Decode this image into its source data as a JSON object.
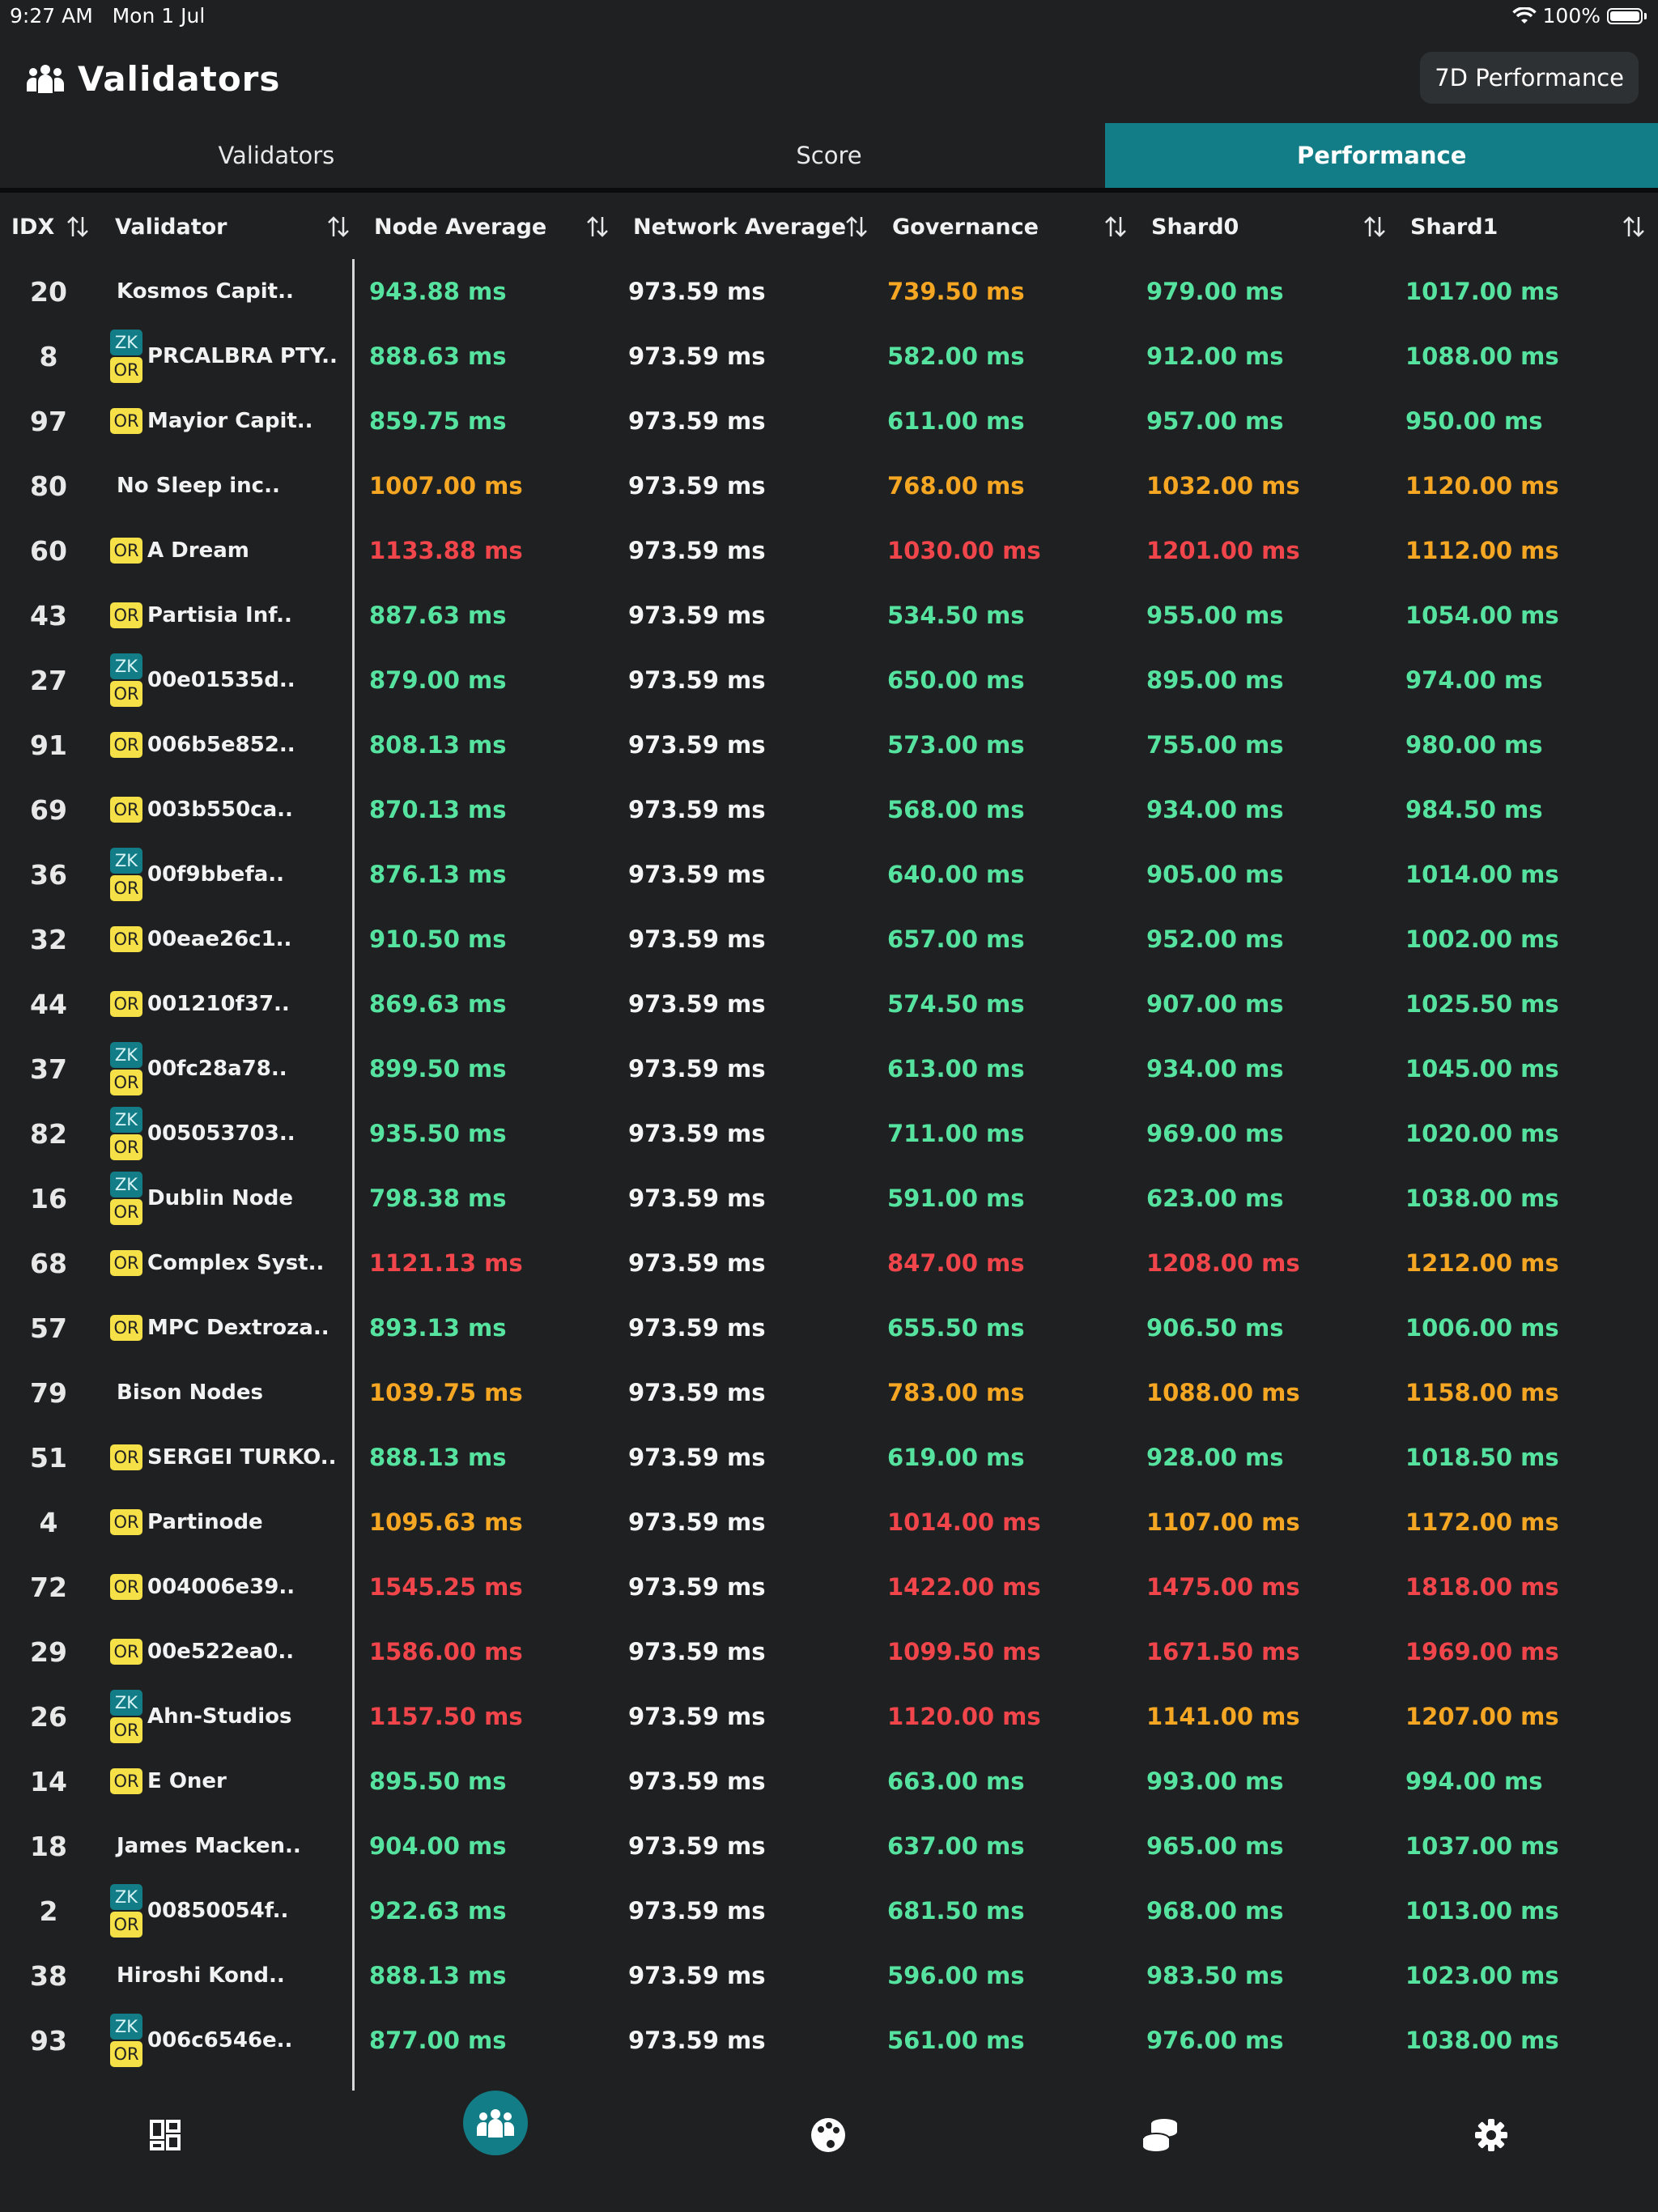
{
  "status": {
    "time": "9:27 AM",
    "date": "Mon 1 Jul",
    "battery": "100%"
  },
  "header": {
    "title": "Validators",
    "icon": "validators-group-icon",
    "perf_button": "7D Performance"
  },
  "tabs": [
    {
      "label": "Validators",
      "active": false
    },
    {
      "label": "Score",
      "active": false
    },
    {
      "label": "Performance",
      "active": true
    }
  ],
  "columns": [
    "IDX",
    "Validator",
    "Node Average",
    "Network Average",
    "Governance",
    "Shard0",
    "Shard1"
  ],
  "colors": {
    "good": "#56e3a0",
    "warn": "#f5a623",
    "bad": "#f0454a",
    "accent": "#127d86",
    "or_badge": "#f5e047"
  },
  "rows": [
    {
      "idx": "20",
      "name": "Kosmos Capit..",
      "zk": false,
      "or": false,
      "node": [
        "943.88 ms",
        "good"
      ],
      "net": "973.59 ms",
      "gov": [
        "739.50 ms",
        "warn"
      ],
      "s0": [
        "979.00 ms",
        "good"
      ],
      "s1": [
        "1017.00 ms",
        "good"
      ]
    },
    {
      "idx": "8",
      "name": "PRCALBRA PTY..",
      "zk": true,
      "or": true,
      "node": [
        "888.63 ms",
        "good"
      ],
      "net": "973.59 ms",
      "gov": [
        "582.00 ms",
        "good"
      ],
      "s0": [
        "912.00 ms",
        "good"
      ],
      "s1": [
        "1088.00 ms",
        "good"
      ]
    },
    {
      "idx": "97",
      "name": "Mayior Capit..",
      "zk": false,
      "or": true,
      "node": [
        "859.75 ms",
        "good"
      ],
      "net": "973.59 ms",
      "gov": [
        "611.00 ms",
        "good"
      ],
      "s0": [
        "957.00 ms",
        "good"
      ],
      "s1": [
        "950.00 ms",
        "good"
      ]
    },
    {
      "idx": "80",
      "name": "No Sleep inc..",
      "zk": false,
      "or": false,
      "node": [
        "1007.00 ms",
        "warn"
      ],
      "net": "973.59 ms",
      "gov": [
        "768.00 ms",
        "warn"
      ],
      "s0": [
        "1032.00 ms",
        "warn"
      ],
      "s1": [
        "1120.00 ms",
        "warn"
      ]
    },
    {
      "idx": "60",
      "name": "A Dream",
      "zk": false,
      "or": true,
      "node": [
        "1133.88 ms",
        "bad"
      ],
      "net": "973.59 ms",
      "gov": [
        "1030.00 ms",
        "bad"
      ],
      "s0": [
        "1201.00 ms",
        "bad"
      ],
      "s1": [
        "1112.00 ms",
        "warn"
      ]
    },
    {
      "idx": "43",
      "name": "Partisia Inf..",
      "zk": false,
      "or": true,
      "node": [
        "887.63 ms",
        "good"
      ],
      "net": "973.59 ms",
      "gov": [
        "534.50 ms",
        "good"
      ],
      "s0": [
        "955.00 ms",
        "good"
      ],
      "s1": [
        "1054.00 ms",
        "good"
      ]
    },
    {
      "idx": "27",
      "name": "00e01535d..",
      "zk": true,
      "or": true,
      "node": [
        "879.00 ms",
        "good"
      ],
      "net": "973.59 ms",
      "gov": [
        "650.00 ms",
        "good"
      ],
      "s0": [
        "895.00 ms",
        "good"
      ],
      "s1": [
        "974.00 ms",
        "good"
      ]
    },
    {
      "idx": "91",
      "name": "006b5e852..",
      "zk": false,
      "or": true,
      "node": [
        "808.13 ms",
        "good"
      ],
      "net": "973.59 ms",
      "gov": [
        "573.00 ms",
        "good"
      ],
      "s0": [
        "755.00 ms",
        "good"
      ],
      "s1": [
        "980.00 ms",
        "good"
      ]
    },
    {
      "idx": "69",
      "name": "003b550ca..",
      "zk": false,
      "or": true,
      "node": [
        "870.13 ms",
        "good"
      ],
      "net": "973.59 ms",
      "gov": [
        "568.00 ms",
        "good"
      ],
      "s0": [
        "934.00 ms",
        "good"
      ],
      "s1": [
        "984.50 ms",
        "good"
      ]
    },
    {
      "idx": "36",
      "name": "00f9bbefa..",
      "zk": true,
      "or": true,
      "node": [
        "876.13 ms",
        "good"
      ],
      "net": "973.59 ms",
      "gov": [
        "640.00 ms",
        "good"
      ],
      "s0": [
        "905.00 ms",
        "good"
      ],
      "s1": [
        "1014.00 ms",
        "good"
      ]
    },
    {
      "idx": "32",
      "name": "00eae26c1..",
      "zk": false,
      "or": true,
      "node": [
        "910.50 ms",
        "good"
      ],
      "net": "973.59 ms",
      "gov": [
        "657.00 ms",
        "good"
      ],
      "s0": [
        "952.00 ms",
        "good"
      ],
      "s1": [
        "1002.00 ms",
        "good"
      ]
    },
    {
      "idx": "44",
      "name": "001210f37..",
      "zk": false,
      "or": true,
      "node": [
        "869.63 ms",
        "good"
      ],
      "net": "973.59 ms",
      "gov": [
        "574.50 ms",
        "good"
      ],
      "s0": [
        "907.00 ms",
        "good"
      ],
      "s1": [
        "1025.50 ms",
        "good"
      ]
    },
    {
      "idx": "37",
      "name": "00fc28a78..",
      "zk": true,
      "or": true,
      "node": [
        "899.50 ms",
        "good"
      ],
      "net": "973.59 ms",
      "gov": [
        "613.00 ms",
        "good"
      ],
      "s0": [
        "934.00 ms",
        "good"
      ],
      "s1": [
        "1045.00 ms",
        "good"
      ]
    },
    {
      "idx": "82",
      "name": "005053703..",
      "zk": true,
      "or": true,
      "node": [
        "935.50 ms",
        "good"
      ],
      "net": "973.59 ms",
      "gov": [
        "711.00 ms",
        "good"
      ],
      "s0": [
        "969.00 ms",
        "good"
      ],
      "s1": [
        "1020.00 ms",
        "good"
      ]
    },
    {
      "idx": "16",
      "name": "Dublin Node",
      "zk": true,
      "or": true,
      "node": [
        "798.38 ms",
        "good"
      ],
      "net": "973.59 ms",
      "gov": [
        "591.00 ms",
        "good"
      ],
      "s0": [
        "623.00 ms",
        "good"
      ],
      "s1": [
        "1038.00 ms",
        "good"
      ]
    },
    {
      "idx": "68",
      "name": "Complex Syst..",
      "zk": false,
      "or": true,
      "node": [
        "1121.13 ms",
        "bad"
      ],
      "net": "973.59 ms",
      "gov": [
        "847.00 ms",
        "bad"
      ],
      "s0": [
        "1208.00 ms",
        "bad"
      ],
      "s1": [
        "1212.00 ms",
        "warn"
      ]
    },
    {
      "idx": "57",
      "name": "MPC Dextroza..",
      "zk": false,
      "or": true,
      "node": [
        "893.13 ms",
        "good"
      ],
      "net": "973.59 ms",
      "gov": [
        "655.50 ms",
        "good"
      ],
      "s0": [
        "906.50 ms",
        "good"
      ],
      "s1": [
        "1006.00 ms",
        "good"
      ]
    },
    {
      "idx": "79",
      "name": "Bison Nodes",
      "zk": false,
      "or": false,
      "node": [
        "1039.75 ms",
        "warn"
      ],
      "net": "973.59 ms",
      "gov": [
        "783.00 ms",
        "warn"
      ],
      "s0": [
        "1088.00 ms",
        "warn"
      ],
      "s1": [
        "1158.00 ms",
        "warn"
      ]
    },
    {
      "idx": "51",
      "name": "SERGEI TURKO..",
      "zk": false,
      "or": true,
      "node": [
        "888.13 ms",
        "good"
      ],
      "net": "973.59 ms",
      "gov": [
        "619.00 ms",
        "good"
      ],
      "s0": [
        "928.00 ms",
        "good"
      ],
      "s1": [
        "1018.50 ms",
        "good"
      ]
    },
    {
      "idx": "4",
      "name": "Partinode",
      "zk": false,
      "or": true,
      "node": [
        "1095.63 ms",
        "warn"
      ],
      "net": "973.59 ms",
      "gov": [
        "1014.00 ms",
        "bad"
      ],
      "s0": [
        "1107.00 ms",
        "warn"
      ],
      "s1": [
        "1172.00 ms",
        "warn"
      ]
    },
    {
      "idx": "72",
      "name": "004006e39..",
      "zk": false,
      "or": true,
      "node": [
        "1545.25 ms",
        "bad"
      ],
      "net": "973.59 ms",
      "gov": [
        "1422.00 ms",
        "bad"
      ],
      "s0": [
        "1475.00 ms",
        "bad"
      ],
      "s1": [
        "1818.00 ms",
        "bad"
      ]
    },
    {
      "idx": "29",
      "name": "00e522ea0..",
      "zk": false,
      "or": true,
      "node": [
        "1586.00 ms",
        "bad"
      ],
      "net": "973.59 ms",
      "gov": [
        "1099.50 ms",
        "bad"
      ],
      "s0": [
        "1671.50 ms",
        "bad"
      ],
      "s1": [
        "1969.00 ms",
        "bad"
      ]
    },
    {
      "idx": "26",
      "name": "Ahn-Studios",
      "zk": true,
      "or": true,
      "node": [
        "1157.50 ms",
        "bad"
      ],
      "net": "973.59 ms",
      "gov": [
        "1120.00 ms",
        "bad"
      ],
      "s0": [
        "1141.00 ms",
        "warn"
      ],
      "s1": [
        "1207.00 ms",
        "warn"
      ]
    },
    {
      "idx": "14",
      "name": "E Oner",
      "zk": false,
      "or": true,
      "node": [
        "895.50 ms",
        "good"
      ],
      "net": "973.59 ms",
      "gov": [
        "663.00 ms",
        "good"
      ],
      "s0": [
        "993.00 ms",
        "good"
      ],
      "s1": [
        "994.00 ms",
        "good"
      ]
    },
    {
      "idx": "18",
      "name": "James Macken..",
      "zk": false,
      "or": false,
      "node": [
        "904.00 ms",
        "good"
      ],
      "net": "973.59 ms",
      "gov": [
        "637.00 ms",
        "good"
      ],
      "s0": [
        "965.00 ms",
        "good"
      ],
      "s1": [
        "1037.00 ms",
        "good"
      ]
    },
    {
      "idx": "2",
      "name": "00850054f..",
      "zk": true,
      "or": true,
      "node": [
        "922.63 ms",
        "good"
      ],
      "net": "973.59 ms",
      "gov": [
        "681.50 ms",
        "good"
      ],
      "s0": [
        "968.00 ms",
        "good"
      ],
      "s1": [
        "1013.00 ms",
        "good"
      ]
    },
    {
      "idx": "38",
      "name": "Hiroshi Kond..",
      "zk": false,
      "or": false,
      "node": [
        "888.13 ms",
        "good"
      ],
      "net": "973.59 ms",
      "gov": [
        "596.00 ms",
        "good"
      ],
      "s0": [
        "983.50 ms",
        "good"
      ],
      "s1": [
        "1023.00 ms",
        "good"
      ]
    },
    {
      "idx": "93",
      "name": "006c6546e..",
      "zk": true,
      "or": true,
      "node": [
        "877.00 ms",
        "good"
      ],
      "net": "973.59 ms",
      "gov": [
        "561.00 ms",
        "good"
      ],
      "s0": [
        "976.00 ms",
        "good"
      ],
      "s1": [
        "1038.00 ms",
        "good"
      ]
    }
  ],
  "badges": {
    "zk": "ZK",
    "or": "OR"
  },
  "bottom_nav": [
    {
      "icon": "dashboard-icon",
      "active": false
    },
    {
      "icon": "validators-group-icon",
      "active": true
    },
    {
      "icon": "palette-icon",
      "active": false
    },
    {
      "icon": "coins-stack-icon",
      "active": false
    },
    {
      "icon": "gear-icon",
      "active": false
    }
  ]
}
